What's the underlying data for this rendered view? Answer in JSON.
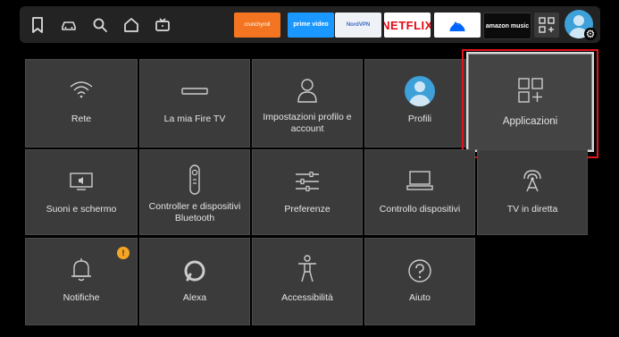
{
  "top_nav": {
    "icons": [
      "bookmark-icon",
      "car-icon",
      "search-icon",
      "home-icon",
      "tv-icon"
    ]
  },
  "apps_row": [
    {
      "name": "crunchyroll",
      "label": "crunchyroll"
    },
    {
      "name": "prime-video",
      "label": "prime video"
    },
    {
      "name": "nordvpn",
      "label": "NordVPN"
    },
    {
      "name": "netflix",
      "label": "NETFLIX"
    },
    {
      "name": "paramount",
      "label": ""
    },
    {
      "name": "amazon-music",
      "label": "amazon music"
    }
  ],
  "settings": {
    "tiles": [
      {
        "label": "Rete",
        "icon": "wifi-icon"
      },
      {
        "label": "La mia Fire TV",
        "icon": "fire-tv-stick-icon"
      },
      {
        "label": "Impostazioni profilo e account",
        "icon": "person-icon"
      },
      {
        "label": "Profili",
        "icon": "profile-avatar-icon"
      },
      {
        "label": "Applicazioni",
        "icon": "apps-grid-icon"
      },
      {
        "label": "Suoni e schermo",
        "icon": "tv-sound-icon"
      },
      {
        "label": "Controller e dispositivi Bluetooth",
        "icon": "remote-icon"
      },
      {
        "label": "Preferenze",
        "icon": "sliders-icon"
      },
      {
        "label": "Controllo dispositivi",
        "icon": "tv-on-stand-icon"
      },
      {
        "label": "TV in diretta",
        "icon": "antenna-icon"
      },
      {
        "label": "Notifiche",
        "icon": "bell-icon",
        "badge": "!"
      },
      {
        "label": "Alexa",
        "icon": "alexa-icon"
      },
      {
        "label": "Accessibilità",
        "icon": "accessibility-icon"
      },
      {
        "label": "Aiuto",
        "icon": "help-icon"
      }
    ],
    "selected": "Applicazioni"
  },
  "colors": {
    "focus_ring": "#e1131e",
    "tile_bg": "#3b3b3b",
    "badge": "#f6a623",
    "avatar": "#3ea0d8"
  }
}
